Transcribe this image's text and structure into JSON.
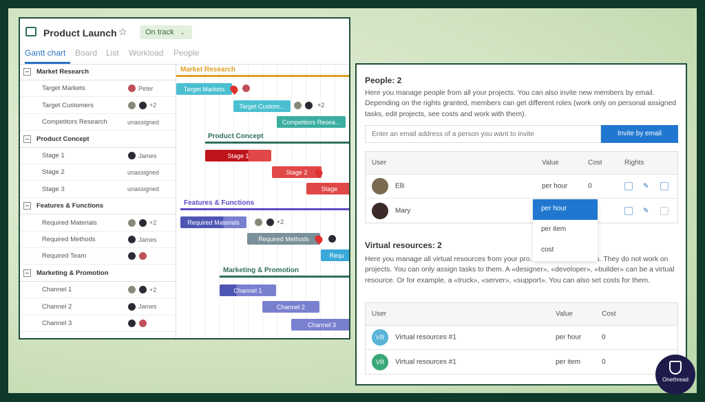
{
  "project": {
    "title": "Product Launch",
    "status": "On track",
    "tabs": [
      "Gantt chart",
      "Board",
      "List",
      "Workload",
      "People"
    ],
    "active_tab": "Gantt chart"
  },
  "list": [
    {
      "type": "group",
      "name": "Market Research"
    },
    {
      "type": "task",
      "name": "Target Markets",
      "assignee": "Peter",
      "avatars": [
        "r"
      ]
    },
    {
      "type": "task",
      "name": "Target Customers",
      "avatars": [
        "g",
        "d"
      ],
      "more": "+2"
    },
    {
      "type": "task",
      "name": "Competitors Research",
      "assignee": "unassigned"
    },
    {
      "type": "group",
      "name": "Product Concept"
    },
    {
      "type": "task",
      "name": "Stage 1",
      "assignee": "James",
      "avatars": [
        "d"
      ]
    },
    {
      "type": "task",
      "name": "Stage 2",
      "assignee": "unassigned"
    },
    {
      "type": "task",
      "name": "Stage 3",
      "assignee": "unassigned"
    },
    {
      "type": "group",
      "name": "Features & Functions"
    },
    {
      "type": "task",
      "name": "Required Materials",
      "avatars": [
        "g",
        "d"
      ],
      "more": "+2"
    },
    {
      "type": "task",
      "name": "Required Methods",
      "assignee": "James",
      "avatars": [
        "d"
      ]
    },
    {
      "type": "task",
      "name": "Required Team",
      "avatars": [
        "d",
        "r"
      ]
    },
    {
      "type": "group",
      "name": "Marketing & Promotion"
    },
    {
      "type": "task",
      "name": "Channel 1",
      "avatars": [
        "g",
        "d"
      ],
      "more": "+2"
    },
    {
      "type": "task",
      "name": "Channel 2",
      "assignee": "James",
      "avatars": [
        "d"
      ]
    },
    {
      "type": "task",
      "name": "Channel 3",
      "avatars": [
        "d",
        "r"
      ]
    }
  ],
  "gantt": {
    "groups": [
      {
        "label": "Market Research",
        "color": "#e0a020"
      },
      {
        "label": "Product Concept",
        "color": "#2e6e5e"
      },
      {
        "label": "Features & Functions",
        "color": "#5b4bc4"
      },
      {
        "label": "Marketing & Promotion",
        "color": "#2e6e5e"
      }
    ],
    "bars": [
      "Target Markets",
      "Target Custom...",
      "Competitors Resea...",
      "Stage 1",
      "Stage 2",
      "Stage",
      "Required Materials",
      "Required Methods",
      "Requ",
      "Channel 1",
      "Channel 2",
      "Channel 3"
    ],
    "more": "+2"
  },
  "people": {
    "title": "People: 2",
    "desc": "Here you manage people from all your projects. You can also invite new members by email. Depending on the rights granted, members can get different roles (work only on personal assigned tasks, edit projects, see costs and work with them).",
    "invite_placeholder": "Enter an email address of a person you want to invite",
    "invite_button": "Invite by email",
    "columns": [
      "User",
      "Value",
      "Cost",
      "Rights"
    ],
    "rows": [
      {
        "name": "Elli",
        "value": "per hour",
        "cost": "0"
      },
      {
        "name": "Mary"
      }
    ],
    "dropdown": [
      "per hour",
      "per item",
      "cost"
    ],
    "dropdown_selected": "per hour"
  },
  "virtual": {
    "title": "Virtual resources: 2",
    "desc": "Here you manage all virtual resources from your pro… add new resources. They do not work on projects. You can only assign tasks to them. A «designer», «developer», «builder» can be a virtual resource. Or for example, a «truck», «server», «support». You can also set costs for them.",
    "columns": [
      "User",
      "Value",
      "Cost"
    ],
    "rows": [
      {
        "initials": "VR",
        "name": "Virtual resources #1",
        "value": "per hour",
        "cost": "0",
        "color": "#5ab4d8"
      },
      {
        "initials": "VR",
        "name": "Virtual resources #1",
        "value": "per item",
        "cost": "0",
        "color": "#3aa878"
      }
    ]
  },
  "brand": {
    "name": "Onethread",
    "color": "#1e1b4b"
  }
}
